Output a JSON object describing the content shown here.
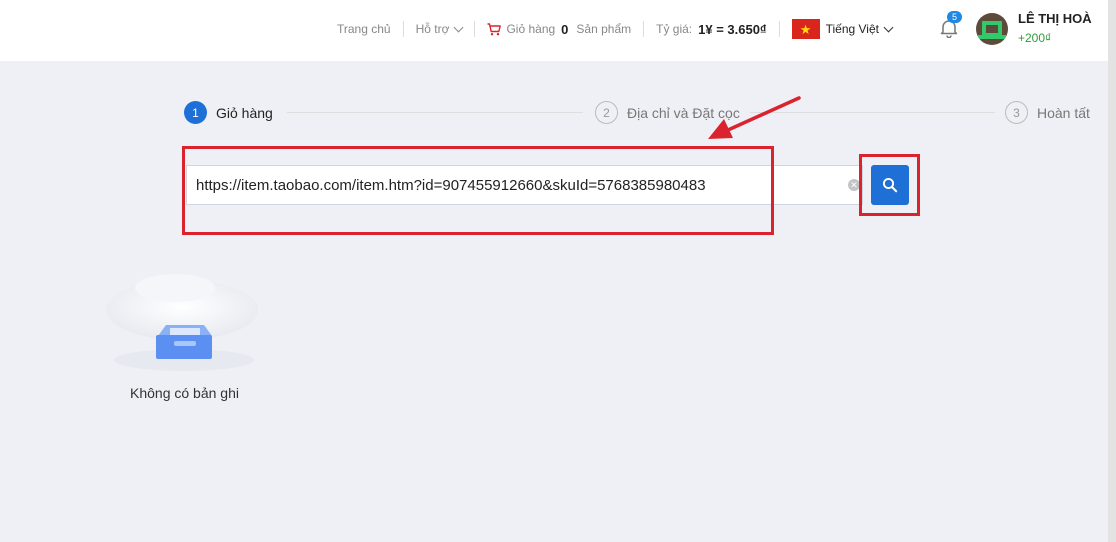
{
  "header": {
    "nav": {
      "home": "Trang chủ",
      "support": "Hỗ trợ",
      "cart_label": "Giỏ hàng",
      "cart_count": "0",
      "cart_unit": "Sản phẩm",
      "rate_label": "Tỷ giá:",
      "rate_value": "1¥ = 3.650₫",
      "language": "Tiếng Việt"
    },
    "notifications": {
      "count": "5"
    },
    "user": {
      "name": "LÊ THỊ HOÀ",
      "balance": "+200₫"
    }
  },
  "steps": [
    {
      "number": "1",
      "label": "Giỏ hàng",
      "active": true
    },
    {
      "number": "2",
      "label": "Địa chỉ và Đặt cọc",
      "active": false
    },
    {
      "number": "3",
      "label": "Hoàn tất",
      "active": false
    }
  ],
  "search": {
    "value": "https://item.taobao.com/item.htm?id=907455912660&skuId=5768385980483"
  },
  "empty_state": {
    "text": "Không có bản ghi"
  },
  "colors": {
    "primary": "#1e6fd6",
    "annotation": "#d9232e",
    "balance": "#2e9e3a",
    "background": "#eef0f5"
  },
  "icons": [
    "cart-icon",
    "bell-icon",
    "search-icon",
    "clear-icon",
    "vietnam-flag-icon",
    "empty-box-icon"
  ]
}
